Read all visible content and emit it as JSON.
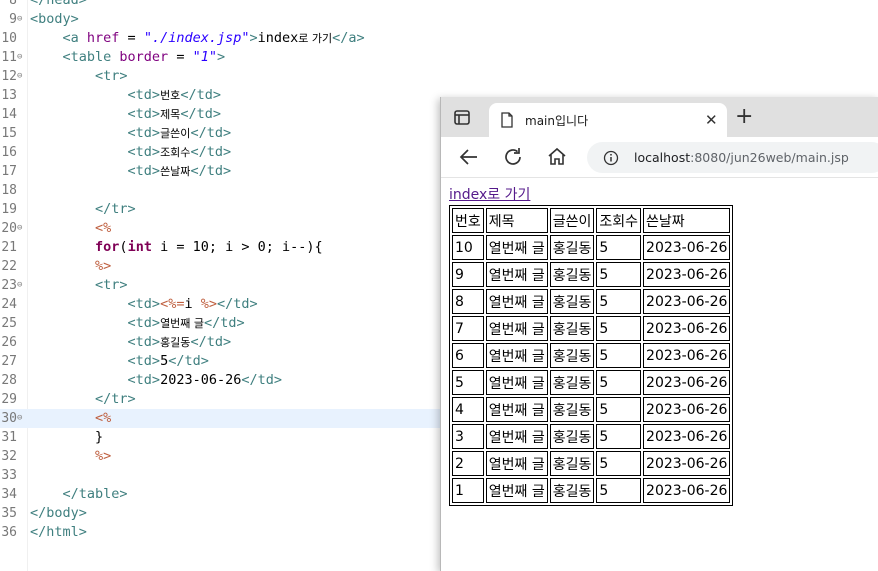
{
  "editor": {
    "lines": [
      {
        "n": "8",
        "fold": false,
        "current": false,
        "parts": [
          {
            "c": "t-tag",
            "t": "</head>"
          }
        ]
      },
      {
        "n": "9",
        "fold": true,
        "current": false,
        "parts": [
          {
            "c": "t-tag",
            "t": "<body>"
          }
        ]
      },
      {
        "n": "10",
        "fold": false,
        "current": false,
        "parts": [
          {
            "c": "t-txt",
            "t": "    "
          },
          {
            "c": "t-tag",
            "t": "<a "
          },
          {
            "c": "t-attr",
            "t": "href"
          },
          {
            "c": "t-txt",
            "t": " = "
          },
          {
            "c": "t-str",
            "t": "\"./index.jsp\""
          },
          {
            "c": "t-tag",
            "t": ">"
          },
          {
            "c": "t-txt",
            "t": "index"
          },
          {
            "c": "t-txt t-kor",
            "t": "로 가기"
          },
          {
            "c": "t-tag",
            "t": "</a>"
          }
        ]
      },
      {
        "n": "11",
        "fold": true,
        "current": false,
        "parts": [
          {
            "c": "t-txt",
            "t": "    "
          },
          {
            "c": "t-tag",
            "t": "<table "
          },
          {
            "c": "t-attr",
            "t": "border"
          },
          {
            "c": "t-txt",
            "t": " = "
          },
          {
            "c": "t-str",
            "t": "\"1\""
          },
          {
            "c": "t-tag",
            "t": ">"
          }
        ]
      },
      {
        "n": "12",
        "fold": true,
        "current": false,
        "parts": [
          {
            "c": "t-txt",
            "t": "        "
          },
          {
            "c": "t-tag",
            "t": "<tr>"
          }
        ]
      },
      {
        "n": "13",
        "fold": false,
        "current": false,
        "parts": [
          {
            "c": "t-txt",
            "t": "            "
          },
          {
            "c": "t-tag",
            "t": "<td>"
          },
          {
            "c": "t-txt t-kor",
            "t": "번호"
          },
          {
            "c": "t-tag",
            "t": "</td>"
          }
        ]
      },
      {
        "n": "14",
        "fold": false,
        "current": false,
        "parts": [
          {
            "c": "t-txt",
            "t": "            "
          },
          {
            "c": "t-tag",
            "t": "<td>"
          },
          {
            "c": "t-txt t-kor",
            "t": "제목"
          },
          {
            "c": "t-tag",
            "t": "</td>"
          }
        ]
      },
      {
        "n": "15",
        "fold": false,
        "current": false,
        "parts": [
          {
            "c": "t-txt",
            "t": "            "
          },
          {
            "c": "t-tag",
            "t": "<td>"
          },
          {
            "c": "t-txt t-kor",
            "t": "글쓴이"
          },
          {
            "c": "t-tag",
            "t": "</td>"
          }
        ]
      },
      {
        "n": "16",
        "fold": false,
        "current": false,
        "parts": [
          {
            "c": "t-txt",
            "t": "            "
          },
          {
            "c": "t-tag",
            "t": "<td>"
          },
          {
            "c": "t-txt t-kor",
            "t": "조회수"
          },
          {
            "c": "t-tag",
            "t": "</td>"
          }
        ]
      },
      {
        "n": "17",
        "fold": false,
        "current": false,
        "parts": [
          {
            "c": "t-txt",
            "t": "            "
          },
          {
            "c": "t-tag",
            "t": "<td>"
          },
          {
            "c": "t-txt t-kor",
            "t": "쓴날짜"
          },
          {
            "c": "t-tag",
            "t": "</td>"
          }
        ]
      },
      {
        "n": "18",
        "fold": false,
        "current": false,
        "parts": []
      },
      {
        "n": "19",
        "fold": false,
        "current": false,
        "parts": [
          {
            "c": "t-txt",
            "t": "        "
          },
          {
            "c": "t-tag",
            "t": "</tr>"
          }
        ]
      },
      {
        "n": "20",
        "fold": true,
        "current": false,
        "parts": [
          {
            "c": "t-txt",
            "t": "        "
          },
          {
            "c": "t-jsp",
            "t": "<%"
          }
        ]
      },
      {
        "n": "21",
        "fold": false,
        "current": false,
        "parts": [
          {
            "c": "t-txt",
            "t": "        "
          },
          {
            "c": "t-kw",
            "t": "for"
          },
          {
            "c": "t-txt",
            "t": "("
          },
          {
            "c": "t-kw",
            "t": "int"
          },
          {
            "c": "t-txt",
            "t": " i = 10; i > 0; i--){"
          }
        ]
      },
      {
        "n": "22",
        "fold": false,
        "current": false,
        "parts": [
          {
            "c": "t-txt",
            "t": "        "
          },
          {
            "c": "t-jsp",
            "t": "%>"
          }
        ]
      },
      {
        "n": "23",
        "fold": true,
        "current": false,
        "parts": [
          {
            "c": "t-txt",
            "t": "        "
          },
          {
            "c": "t-tag",
            "t": "<tr>"
          }
        ]
      },
      {
        "n": "24",
        "fold": false,
        "current": false,
        "parts": [
          {
            "c": "t-txt",
            "t": "            "
          },
          {
            "c": "t-tag",
            "t": "<td>"
          },
          {
            "c": "t-jsp",
            "t": "<%="
          },
          {
            "c": "t-txt",
            "t": "i "
          },
          {
            "c": "t-jsp",
            "t": "%>"
          },
          {
            "c": "t-tag",
            "t": "</td>"
          }
        ]
      },
      {
        "n": "25",
        "fold": false,
        "current": false,
        "parts": [
          {
            "c": "t-txt",
            "t": "            "
          },
          {
            "c": "t-tag",
            "t": "<td>"
          },
          {
            "c": "t-txt t-kor",
            "t": "열번째 글"
          },
          {
            "c": "t-tag",
            "t": "</td>"
          }
        ]
      },
      {
        "n": "26",
        "fold": false,
        "current": false,
        "parts": [
          {
            "c": "t-txt",
            "t": "            "
          },
          {
            "c": "t-tag",
            "t": "<td>"
          },
          {
            "c": "t-txt t-kor",
            "t": "홍길동"
          },
          {
            "c": "t-tag",
            "t": "</td>"
          }
        ]
      },
      {
        "n": "27",
        "fold": false,
        "current": false,
        "parts": [
          {
            "c": "t-txt",
            "t": "            "
          },
          {
            "c": "t-tag",
            "t": "<td>"
          },
          {
            "c": "t-txt",
            "t": "5"
          },
          {
            "c": "t-tag",
            "t": "</td>"
          }
        ]
      },
      {
        "n": "28",
        "fold": false,
        "current": false,
        "parts": [
          {
            "c": "t-txt",
            "t": "            "
          },
          {
            "c": "t-tag",
            "t": "<td>"
          },
          {
            "c": "t-txt",
            "t": "2023-06-26"
          },
          {
            "c": "t-tag",
            "t": "</td>"
          }
        ]
      },
      {
        "n": "29",
        "fold": false,
        "current": false,
        "parts": [
          {
            "c": "t-txt",
            "t": "        "
          },
          {
            "c": "t-tag",
            "t": "</tr>"
          }
        ]
      },
      {
        "n": "30",
        "fold": true,
        "current": true,
        "parts": [
          {
            "c": "t-txt",
            "t": "        "
          },
          {
            "c": "t-jsp",
            "t": "<%"
          }
        ]
      },
      {
        "n": "31",
        "fold": false,
        "current": false,
        "parts": [
          {
            "c": "t-txt",
            "t": "        }"
          }
        ]
      },
      {
        "n": "32",
        "fold": false,
        "current": false,
        "parts": [
          {
            "c": "t-txt",
            "t": "        "
          },
          {
            "c": "t-jsp",
            "t": "%>"
          }
        ]
      },
      {
        "n": "33",
        "fold": false,
        "current": false,
        "parts": []
      },
      {
        "n": "34",
        "fold": false,
        "current": false,
        "parts": [
          {
            "c": "t-txt",
            "t": "    "
          },
          {
            "c": "t-tag",
            "t": "</table>"
          }
        ]
      },
      {
        "n": "35",
        "fold": false,
        "current": false,
        "parts": [
          {
            "c": "t-tag",
            "t": "</body>"
          }
        ]
      },
      {
        "n": "36",
        "fold": false,
        "current": false,
        "parts": [
          {
            "c": "t-tag",
            "t": "</html>"
          }
        ]
      }
    ]
  },
  "browser": {
    "tab_title": "main입니다",
    "tab_close": "✕",
    "new_tab": "+",
    "url_host": "localhost",
    "url_rest": ":8080/jun26web/main.jsp",
    "icons": [
      "tab-actions-icon",
      "page-favicon-icon",
      "back-arrow-icon",
      "reload-icon",
      "home-icon",
      "info-icon"
    ]
  },
  "page": {
    "link_text": "index로 가기",
    "table": {
      "header": [
        "번호",
        "제목",
        "글쓴이",
        "조회수",
        "쓴날짜"
      ],
      "rows": [
        [
          "10",
          "열번째 글",
          "홍길동",
          "5",
          "2023-06-26"
        ],
        [
          "9",
          "열번째 글",
          "홍길동",
          "5",
          "2023-06-26"
        ],
        [
          "8",
          "열번째 글",
          "홍길동",
          "5",
          "2023-06-26"
        ],
        [
          "7",
          "열번째 글",
          "홍길동",
          "5",
          "2023-06-26"
        ],
        [
          "6",
          "열번째 글",
          "홍길동",
          "5",
          "2023-06-26"
        ],
        [
          "5",
          "열번째 글",
          "홍길동",
          "5",
          "2023-06-26"
        ],
        [
          "4",
          "열번째 글",
          "홍길동",
          "5",
          "2023-06-26"
        ],
        [
          "3",
          "열번째 글",
          "홍길동",
          "5",
          "2023-06-26"
        ],
        [
          "2",
          "열번째 글",
          "홍길동",
          "5",
          "2023-06-26"
        ],
        [
          "1",
          "열번째 글",
          "홍길동",
          "5",
          "2023-06-26"
        ]
      ]
    }
  }
}
